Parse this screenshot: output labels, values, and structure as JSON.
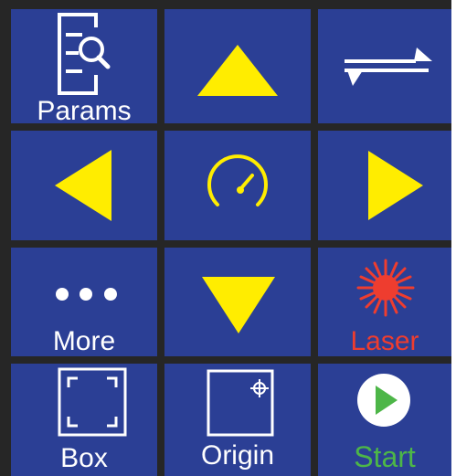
{
  "colors": {
    "background": "#262626",
    "button": "#2b3f95",
    "arrow": "#ffed00",
    "icon_white": "#ffffff",
    "laser": "#ee3d2f",
    "start_green": "#4db648"
  },
  "buttons": {
    "params": {
      "label": "Params",
      "icon": "document-search-icon"
    },
    "up": {
      "icon": "arrow-up-icon"
    },
    "swap": {
      "icon": "swap-direction-icon"
    },
    "left": {
      "icon": "arrow-left-icon"
    },
    "speed": {
      "icon": "speedometer-icon"
    },
    "right": {
      "icon": "arrow-right-icon"
    },
    "more": {
      "label": "More",
      "icon": "more-dots-icon"
    },
    "down": {
      "icon": "arrow-down-icon"
    },
    "laser": {
      "label": "Laser",
      "icon": "laser-burst-icon"
    },
    "box": {
      "label": "Box",
      "icon": "box-frame-icon"
    },
    "origin": {
      "label": "Origin",
      "icon": "origin-crosshair-icon"
    },
    "start": {
      "label": "Start",
      "icon": "play-icon"
    }
  }
}
